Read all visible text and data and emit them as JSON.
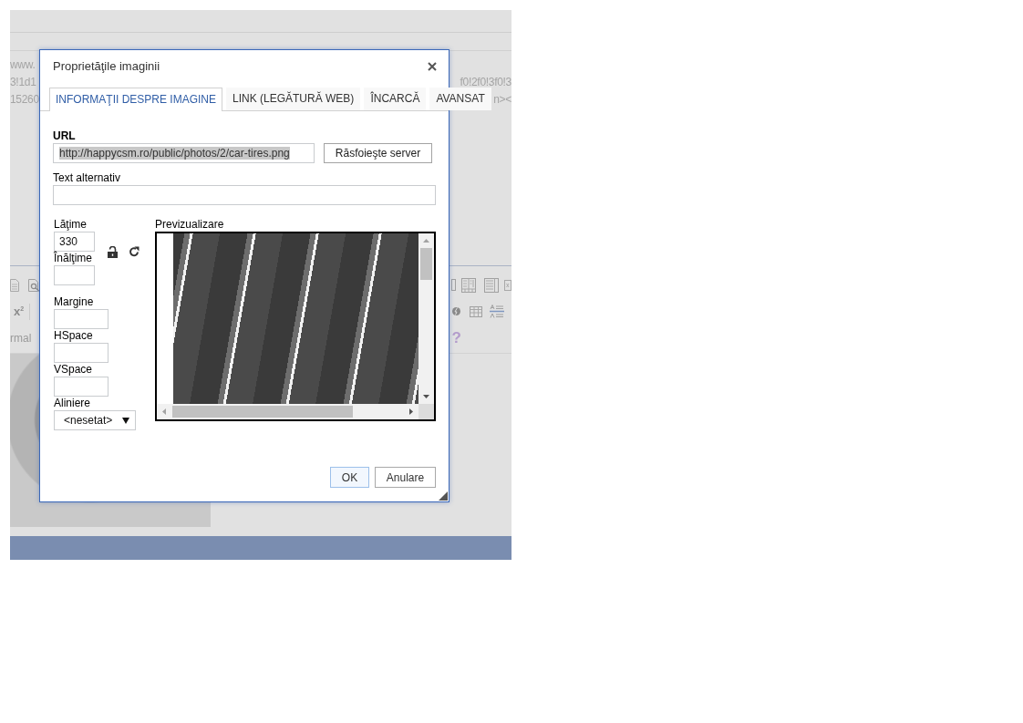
{
  "background": {
    "source_lines": [
      {
        "start": "www."
      },
      {
        "start": "3!1d1",
        "end": "f0!2f0!3f0!3"
      },
      {
        "start": "15260",
        "end": "n><"
      }
    ],
    "toolbar": {
      "superscript": "x$^{2}$",
      "format": "rmal",
      "help": "?"
    }
  },
  "dialog": {
    "title": "Proprietăţile imaginii",
    "tabs": [
      {
        "label": "INFORMAŢII DESPRE IMAGINE",
        "selected": true
      },
      {
        "label": "LINK (LEGĂTURĂ WEB)",
        "selected": false
      },
      {
        "label": "ÎNCARCĂ",
        "selected": false
      },
      {
        "label": "AVANSAT",
        "selected": false
      }
    ],
    "url": {
      "label": "URL",
      "value": "http://happycsm.ro/public/photos/2/car-tires.png",
      "highlighted": true
    },
    "browse_button": "Răsfoieşte server",
    "alt_text": {
      "label": "Text alternativ"
    },
    "width": {
      "label": "Lăţime",
      "value": "330"
    },
    "height": {
      "label": "Înălţime"
    },
    "lock_ratio": false,
    "margin": {
      "label": "Margine"
    },
    "hspace": {
      "label": "HSpace"
    },
    "vspace": {
      "label": "VSpace"
    },
    "align": {
      "label": "Aliniere",
      "value": "<nesetat>"
    },
    "preview": {
      "label": "Previzualizare"
    },
    "buttons": [
      {
        "label": "OK",
        "kind": "primary"
      },
      {
        "label": "Anulare",
        "kind": "secondary"
      }
    ]
  }
}
